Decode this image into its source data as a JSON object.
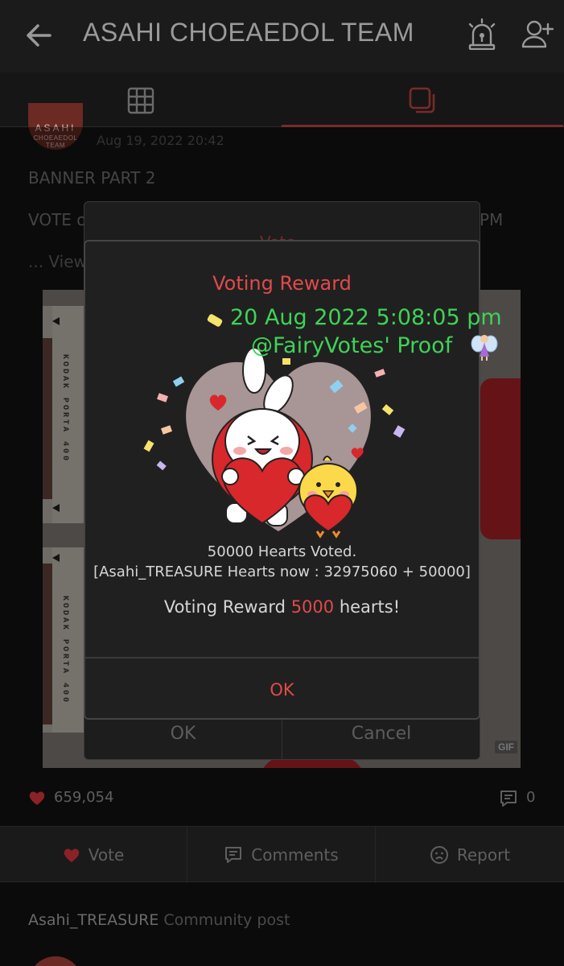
{
  "header": {
    "title": "ASAHI CHOEAEDOL TEAM",
    "back_icon": "arrow-left-icon",
    "report_icon": "siren-icon",
    "add_user_icon": "add-user-icon"
  },
  "tabs": [
    {
      "icon": "grid-icon",
      "active": false
    },
    {
      "icon": "post-list-icon",
      "active": true
    }
  ],
  "post": {
    "avatar_text_big": "ASAHI",
    "avatar_text_small": "CHOEAEDOL TEAM",
    "date": "Aug 19, 2022 20:42",
    "line1": "BANNER PART 2",
    "line2_start": "VOTE o",
    "line2_end": "PM",
    "more": "... View",
    "gif_badge": "GIF",
    "film_label_1": "KODAK PORTA 400",
    "film_label_2": "KODAK PORTA 400"
  },
  "back_dialog": {
    "title": "Vote",
    "ok": "OK",
    "cancel": "Cancel"
  },
  "reward_dialog": {
    "title": "Voting Reward",
    "voted_line": "50000 Hearts Voted.",
    "hearts_now_line": "[Asahi_TREASURE Hearts now : 32975060 + 50000]",
    "reward_prefix": "Voting Reward ",
    "reward_amount": "5000",
    "reward_suffix": " hearts!",
    "ok": "OK"
  },
  "proof": {
    "timestamp": "20 Aug 2022 5:08:05 pm",
    "handle": "@FairyVotes' Proof"
  },
  "stats": {
    "likes": "659,054",
    "comments": "0"
  },
  "actions": {
    "vote": "Vote",
    "comments": "Comments",
    "report": "Report"
  },
  "next_post": {
    "author": "Asahi_TREASURE",
    "kind": " Community post"
  },
  "colors": {
    "accent_red": "#e04a4a",
    "proof_green": "#3fd257",
    "background": "#141414"
  }
}
